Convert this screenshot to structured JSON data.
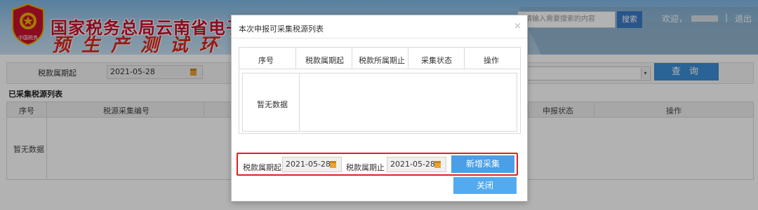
{
  "header": {
    "title": "国家税务总局云南省电子税",
    "subtitle": "预生产测试环",
    "emblem_text": "中国税务",
    "search_placeholder": "请输入需要搜索的内容",
    "search_button": "搜索",
    "welcome": "欢迎，",
    "separator": "|",
    "logout": "退出"
  },
  "filter": {
    "period_label": "税款属期起",
    "period_value": "2021-05-28",
    "query_button": "查 询"
  },
  "collected_list": {
    "title": "已采集税源列表",
    "columns": [
      "序号",
      "税源采集编号",
      "申报状态",
      "操作"
    ],
    "empty_text": "暂无数据"
  },
  "modal": {
    "title": "本次申报可采集税源列表",
    "close_icon": "×",
    "table": {
      "columns": [
        "序号",
        "税款属期起",
        "税款所属期止",
        "采集状态",
        "操作"
      ],
      "empty_text": "暂无数据"
    },
    "form": {
      "start_label": "税款属期起",
      "start_value": "2021-05-28",
      "end_label": "税款属期止",
      "end_value": "2021-05-28",
      "add_button": "新增采集"
    },
    "close_button": "关闭"
  },
  "colors": {
    "primary_button": "#4a9fe6",
    "highlight_border": "#e02020",
    "title_red": "#c8102e"
  }
}
